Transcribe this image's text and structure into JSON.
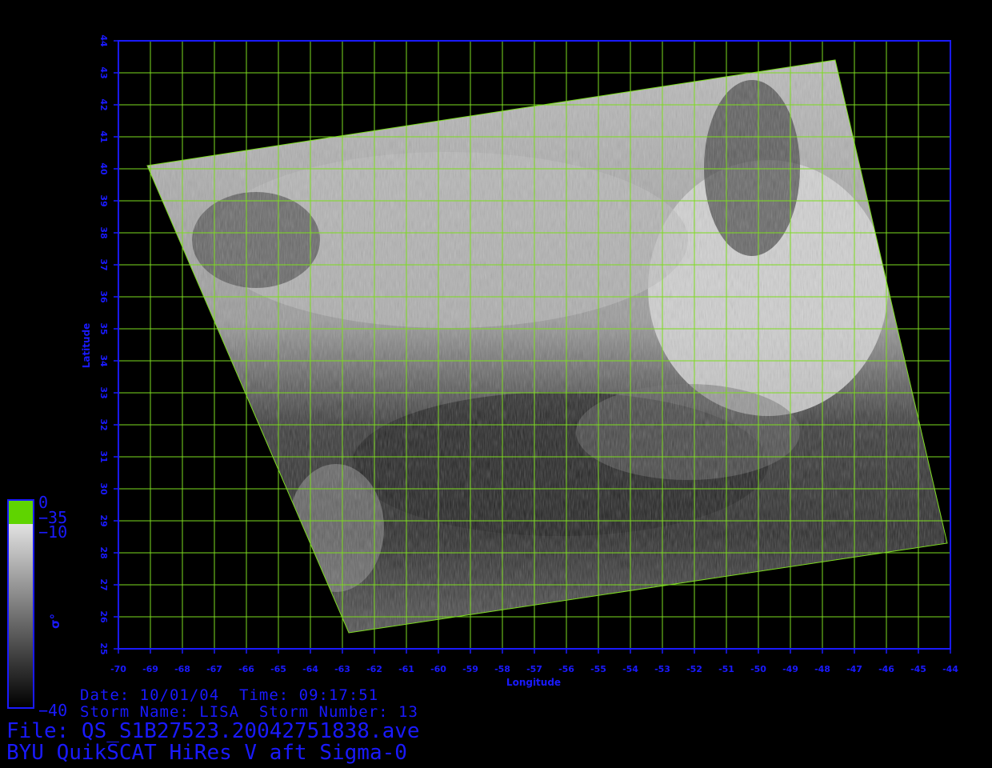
{
  "map": {
    "lon_min": -70,
    "lon_max": -44,
    "lat_min": 25,
    "lat_max": 44,
    "lon_ticks": [
      "-70",
      "-69",
      "-68",
      "-67",
      "-66",
      "-65",
      "-64",
      "-63",
      "-62",
      "-61",
      "-60",
      "-59",
      "-58",
      "-57",
      "-56",
      "-55",
      "-54",
      "-53",
      "-52",
      "-51",
      "-50",
      "-49",
      "-48",
      "-47",
      "-46",
      "-45",
      "-44"
    ],
    "lat_ticks": [
      "25",
      "26",
      "27",
      "28",
      "29",
      "30",
      "31",
      "32",
      "33",
      "34",
      "35",
      "36",
      "37",
      "38",
      "39",
      "40",
      "41",
      "42",
      "43",
      "44"
    ],
    "x_label": "Longitude",
    "y_label": "Latitude",
    "swath_corners_lonlat": [
      [
        -69.1,
        40.1
      ],
      [
        -47.6,
        43.4
      ],
      [
        -44.1,
        28.3
      ],
      [
        -62.8,
        25.5
      ]
    ],
    "grid_color": "#7ddc1f",
    "axis_color": "#1a1aff"
  },
  "colorbar": {
    "symbol": "σ°",
    "tick_top": "0",
    "tick_2": "−35",
    "tick_3": "−10",
    "tick_bottom": "−40",
    "top_color": "#5fd400"
  },
  "info": {
    "line1": "Date: 10/01/04  Time: 09:17:51",
    "line2": "Storm Name: LISA  Storm Number: 13",
    "file": "File: QS_S1B27523.20042751838.ave",
    "title": "BYU QuikSCAT HiRes V aft Sigma-0"
  }
}
